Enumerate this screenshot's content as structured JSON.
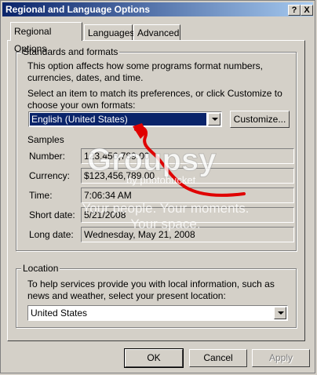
{
  "window": {
    "title": "Regional and Language Options",
    "help_button": "?",
    "close_button": "X"
  },
  "tabs": [
    {
      "label": "Regional Options",
      "active": true
    },
    {
      "label": "Languages",
      "active": false
    },
    {
      "label": "Advanced",
      "active": false
    }
  ],
  "standards": {
    "legend": "Standards and formats",
    "description": "This option affects how some programs format numbers, currencies, dates, and time.",
    "select_prompt": "Select an item to match its preferences, or click Customize to choose your own formats:",
    "selected_format": "English (United States)",
    "customize_label": "Customize...",
    "samples_label": "Samples",
    "samples": [
      {
        "label": "Number:",
        "value": "123,456,789.00"
      },
      {
        "label": "Currency:",
        "value": "$123,456,789.00"
      },
      {
        "label": "Time:",
        "value": "7:06:34 AM"
      },
      {
        "label": "Short date:",
        "value": "5/21/2008"
      },
      {
        "label": "Long date:",
        "value": "Wednesday, May 21, 2008"
      }
    ]
  },
  "location": {
    "legend": "Location",
    "description": "To help services provide you with local information, such as news and weather, select your present location:",
    "selected": "United States"
  },
  "buttons": {
    "ok": "OK",
    "cancel": "Cancel",
    "apply": "Apply"
  },
  "watermark": {
    "brand": "Groupsy",
    "byline": "by photobucket",
    "tagline_1": "Your people. Your moments.",
    "tagline_2": "Your space."
  },
  "colors": {
    "title_start": "#0a246a",
    "title_end": "#a6caf0",
    "selection": "#0a246a",
    "annotation": "#e00000"
  }
}
